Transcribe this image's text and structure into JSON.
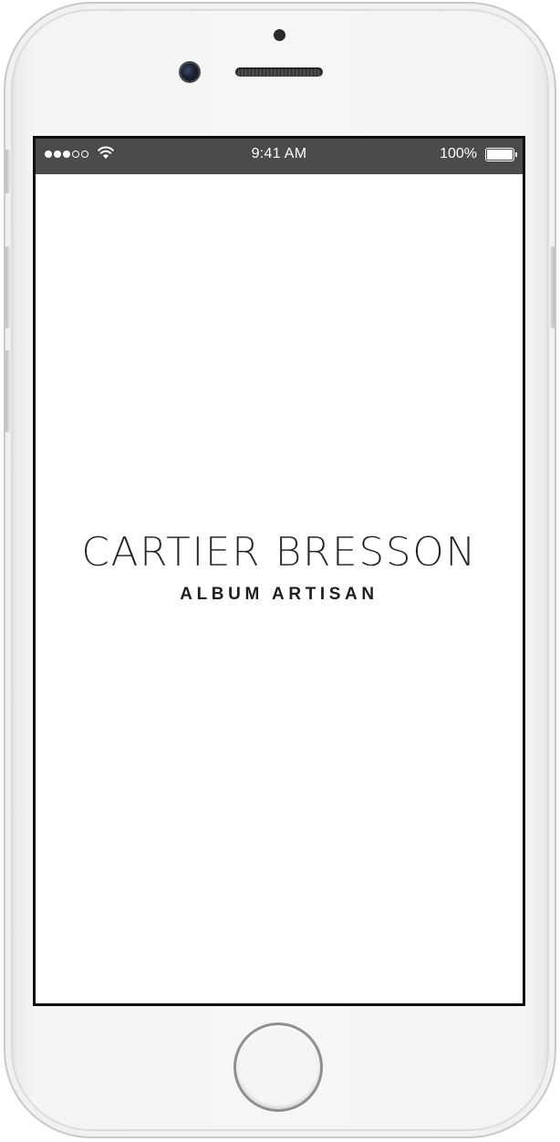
{
  "status_bar": {
    "time": "9:41 AM",
    "battery_percent": "100%",
    "signal_bars_filled": 3,
    "signal_bars_total": 5,
    "battery_level": 1.0
  },
  "splash": {
    "title": "CARTIER BRESSON",
    "subtitle": "ALBUM ARTISAN"
  },
  "colors": {
    "status_bar_bg": "#4b4b4d",
    "screen_bg": "#ffffff",
    "text": "#222222"
  },
  "icons": [
    "signal-strength-icon",
    "wifi-icon",
    "battery-icon"
  ]
}
